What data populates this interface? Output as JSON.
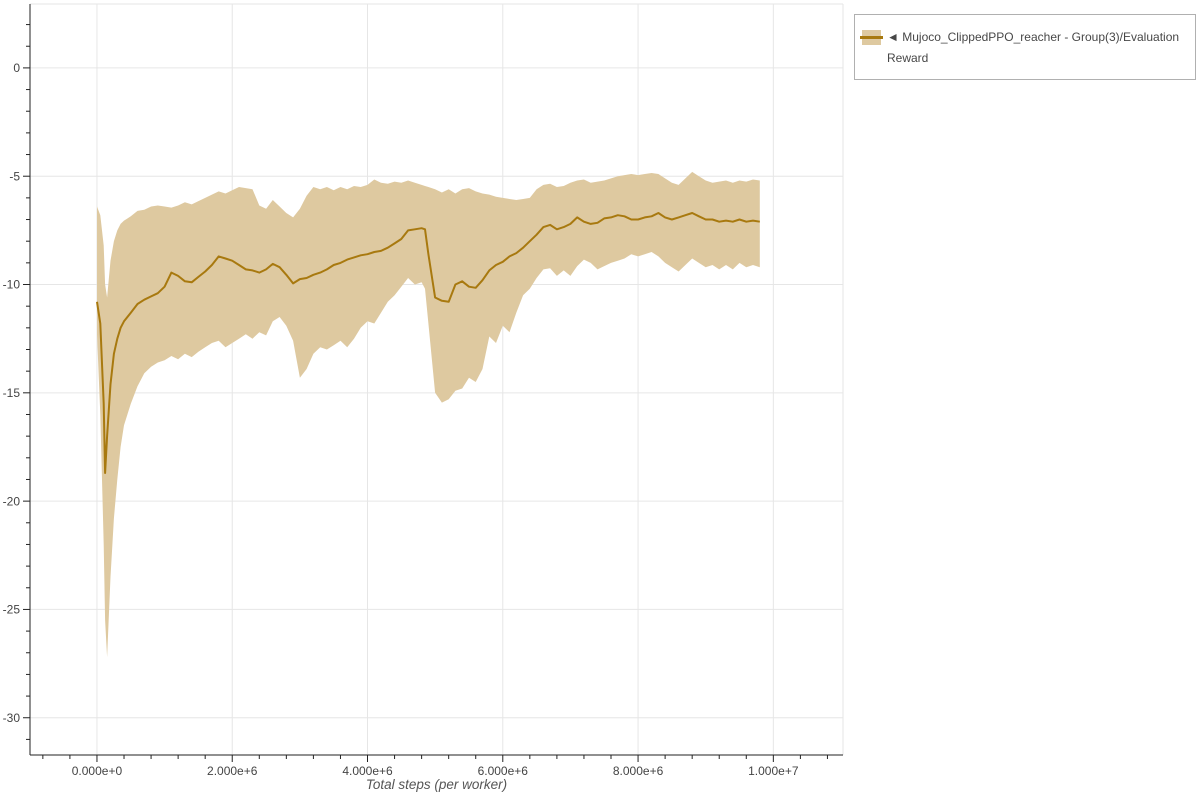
{
  "chart_data": {
    "type": "line",
    "title": "",
    "xlabel": "Total steps (per worker)",
    "ylabel": "",
    "grid": true,
    "x_range": [
      -990000,
      11030000
    ],
    "y_range": [
      -31.72,
      2.95
    ],
    "x_axis": {
      "minor_step": 400000,
      "ticks": [
        {
          "value": 0,
          "label": "0.000e+0"
        },
        {
          "value": 2000000,
          "label": "2.000e+6"
        },
        {
          "value": 4000000,
          "label": "4.000e+6"
        },
        {
          "value": 6000000,
          "label": "6.000e+6"
        },
        {
          "value": 8000000,
          "label": "8.000e+6"
        },
        {
          "value": 10000000,
          "label": "1.000e+7"
        }
      ]
    },
    "y_axis": {
      "minor_step": 1,
      "ticks": [
        {
          "value": 0,
          "label": "0"
        },
        {
          "value": -5,
          "label": "-5"
        },
        {
          "value": -10,
          "label": "-10"
        },
        {
          "value": -15,
          "label": "-15"
        },
        {
          "value": -20,
          "label": "-20"
        },
        {
          "value": -25,
          "label": "-25"
        },
        {
          "value": -30,
          "label": "-30"
        }
      ]
    },
    "legend": {
      "position": "top-right",
      "marker": "◄",
      "label": "Mujoco_ClippedPPO_reacher - Group(3)/Evaluation Reward"
    },
    "colors": {
      "line": "#a8790f",
      "band": "#dec9a0",
      "grid": "#e6e6e6",
      "axis": "#222222",
      "tick_label": "#444444",
      "xlabel": "#555555",
      "legend_border": "#b0b0b0",
      "legend_text": "#474747",
      "background": "#ffffff"
    },
    "series": [
      {
        "name": "Mujoco_ClippedPPO_reacher - Group(3)/Evaluation Reward",
        "x_millions": [
          0,
          0.05,
          0.1,
          0.12,
          0.15,
          0.2,
          0.25,
          0.3,
          0.35,
          0.4,
          0.5,
          0.6,
          0.7,
          0.8,
          0.9,
          1.0,
          1.1,
          1.2,
          1.3,
          1.4,
          1.5,
          1.6,
          1.7,
          1.8,
          1.9,
          2.0,
          2.1,
          2.2,
          2.3,
          2.4,
          2.5,
          2.6,
          2.7,
          2.8,
          2.9,
          3.0,
          3.1,
          3.2,
          3.3,
          3.4,
          3.5,
          3.6,
          3.7,
          3.8,
          3.9,
          4.0,
          4.1,
          4.2,
          4.3,
          4.4,
          4.5,
          4.6,
          4.7,
          4.8,
          4.85,
          4.9,
          5.0,
          5.1,
          5.2,
          5.3,
          5.4,
          5.5,
          5.6,
          5.7,
          5.8,
          5.9,
          6.0,
          6.1,
          6.2,
          6.3,
          6.4,
          6.5,
          6.6,
          6.7,
          6.8,
          6.9,
          7.0,
          7.1,
          7.2,
          7.3,
          7.4,
          7.5,
          7.6,
          7.7,
          7.8,
          7.9,
          8.0,
          8.1,
          8.2,
          8.3,
          8.4,
          8.5,
          8.6,
          8.7,
          8.8,
          8.9,
          9.0,
          9.1,
          9.2,
          9.3,
          9.4,
          9.5,
          9.6,
          9.7,
          9.8
        ],
        "mean": [
          -10.8,
          -11.8,
          -15.5,
          -18.7,
          -17.0,
          -14.6,
          -13.2,
          -12.5,
          -12.0,
          -11.7,
          -11.3,
          -10.9,
          -10.7,
          -10.55,
          -10.4,
          -10.1,
          -9.45,
          -9.6,
          -9.85,
          -9.9,
          -9.65,
          -9.4,
          -9.1,
          -8.7,
          -8.8,
          -8.9,
          -9.1,
          -9.3,
          -9.35,
          -9.45,
          -9.3,
          -9.05,
          -9.2,
          -9.55,
          -9.95,
          -9.75,
          -9.7,
          -9.55,
          -9.45,
          -9.3,
          -9.1,
          -9.0,
          -8.85,
          -8.75,
          -8.65,
          -8.6,
          -8.5,
          -8.45,
          -8.3,
          -8.1,
          -7.9,
          -7.5,
          -7.45,
          -7.4,
          -7.45,
          -8.6,
          -10.6,
          -10.75,
          -10.8,
          -10.0,
          -9.85,
          -10.1,
          -10.15,
          -9.8,
          -9.35,
          -9.1,
          -8.95,
          -8.7,
          -8.55,
          -8.3,
          -8.0,
          -7.7,
          -7.35,
          -7.25,
          -7.45,
          -7.35,
          -7.2,
          -6.9,
          -7.1,
          -7.2,
          -7.15,
          -6.95,
          -6.9,
          -6.8,
          -6.85,
          -7.0,
          -7.0,
          -6.9,
          -6.85,
          -6.7,
          -6.9,
          -7.0,
          -6.9,
          -6.8,
          -6.7,
          -6.85,
          -7.0,
          -7.0,
          -7.1,
          -7.05,
          -7.1,
          -7.0,
          -7.1,
          -7.05,
          -7.1
        ],
        "band_upper": [
          -6.4,
          -6.8,
          -8.2,
          -10.0,
          -10.6,
          -8.9,
          -8.0,
          -7.5,
          -7.2,
          -7.05,
          -6.85,
          -6.6,
          -6.55,
          -6.4,
          -6.35,
          -6.4,
          -6.45,
          -6.35,
          -6.2,
          -6.3,
          -6.15,
          -6.0,
          -5.85,
          -5.7,
          -5.8,
          -5.65,
          -5.5,
          -5.55,
          -5.6,
          -6.35,
          -6.5,
          -6.1,
          -6.4,
          -6.7,
          -6.9,
          -6.5,
          -5.9,
          -5.5,
          -5.6,
          -5.5,
          -5.65,
          -5.5,
          -5.6,
          -5.45,
          -5.5,
          -5.4,
          -5.15,
          -5.3,
          -5.35,
          -5.25,
          -5.3,
          -5.2,
          -5.3,
          -5.4,
          -5.45,
          -5.5,
          -5.6,
          -5.75,
          -5.6,
          -5.8,
          -5.6,
          -5.55,
          -5.7,
          -5.8,
          -5.85,
          -5.95,
          -6.0,
          -6.05,
          -6.1,
          -6.05,
          -6.0,
          -5.6,
          -5.4,
          -5.35,
          -5.5,
          -5.45,
          -5.3,
          -5.2,
          -5.15,
          -5.3,
          -5.25,
          -5.2,
          -5.1,
          -5.0,
          -4.95,
          -4.9,
          -4.95,
          -4.9,
          -4.85,
          -4.9,
          -5.1,
          -5.3,
          -5.4,
          -5.1,
          -4.8,
          -5.0,
          -5.2,
          -5.3,
          -5.25,
          -5.2,
          -5.3,
          -5.2,
          -5.25,
          -5.15,
          -5.2
        ],
        "band_lower": [
          -12.3,
          -16.0,
          -22.0,
          -25.5,
          -27.2,
          -23.5,
          -20.8,
          -19.0,
          -17.5,
          -16.5,
          -15.5,
          -14.7,
          -14.1,
          -13.8,
          -13.6,
          -13.5,
          -13.3,
          -13.45,
          -13.2,
          -13.35,
          -13.1,
          -12.9,
          -12.7,
          -12.6,
          -12.9,
          -12.7,
          -12.5,
          -12.3,
          -12.5,
          -12.2,
          -12.35,
          -11.7,
          -11.5,
          -11.9,
          -12.6,
          -14.3,
          -13.9,
          -13.2,
          -12.9,
          -13.0,
          -12.8,
          -12.6,
          -12.9,
          -12.5,
          -12.0,
          -11.7,
          -11.8,
          -11.3,
          -10.8,
          -10.5,
          -10.1,
          -9.7,
          -10.0,
          -9.9,
          -10.2,
          -11.8,
          -15.0,
          -15.45,
          -15.3,
          -14.9,
          -14.8,
          -14.3,
          -14.5,
          -13.9,
          -12.4,
          -12.7,
          -11.9,
          -12.2,
          -11.3,
          -10.5,
          -10.2,
          -9.7,
          -9.3,
          -9.25,
          -9.6,
          -9.35,
          -9.6,
          -9.15,
          -8.85,
          -9.0,
          -9.3,
          -9.15,
          -9.0,
          -8.9,
          -8.8,
          -8.6,
          -8.7,
          -8.6,
          -8.5,
          -8.7,
          -9.0,
          -9.2,
          -9.4,
          -9.1,
          -8.8,
          -9.0,
          -9.2,
          -9.1,
          -9.3,
          -9.1,
          -9.3,
          -9.0,
          -9.2,
          -9.1,
          -9.2
        ]
      }
    ]
  }
}
